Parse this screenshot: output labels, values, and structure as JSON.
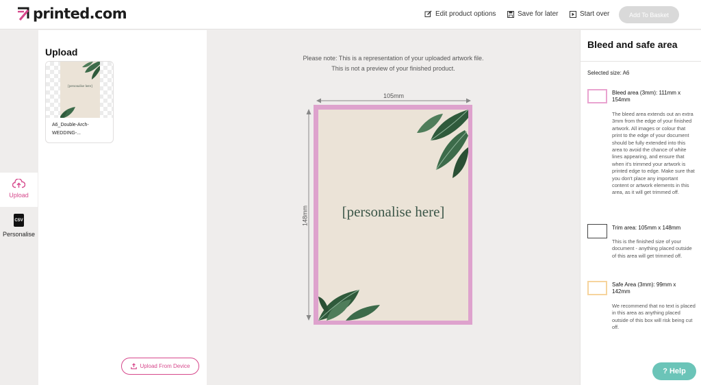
{
  "brand": {
    "name": "printed.com",
    "accent": "#d6478b",
    "help_color": "#6bc4b8"
  },
  "header": {
    "edit_label": "Edit product options",
    "save_label": "Save for later",
    "start_label": "Start over",
    "basket_label": "Add To Basket"
  },
  "rail": {
    "upload_label": "Upload",
    "personalise_label": "Personalise",
    "csv_text": "CSV"
  },
  "upload_panel": {
    "title": "Upload",
    "file_name": "A6_Double-Arch-WEDDING-...",
    "thumb_text": "[personalise here]",
    "upload_button": "Upload From Device"
  },
  "canvas": {
    "note_line1": "Please note: This is a representation of your uploaded artwork file.",
    "note_line2": "This is not a preview of your finished product.",
    "width_label": "105mm",
    "height_label": "148mm",
    "artwork_text": "[personalise here]"
  },
  "info": {
    "title": "Bleed and safe area",
    "selected_size": "Selected size: A6",
    "bleed_label": "Bleed area (3mm): 111mm x 154mm",
    "bleed_desc": "The bleed area extends out an extra 3mm from the edge of your finished artwork. All images or colour that print to the edge of your document should be fully extended into this area to avoid the chance of white lines appearing, and ensure that when it's trimmed your artwork is printed edge to edge. Make sure that you don't place any important content or artwork elements in this area, as it will get trimmed off.",
    "trim_label": "Trim area: 105mm x 148mm",
    "trim_desc": "This is the finished size of your document - anything placed outside of this area will get trimmed off.",
    "safe_label": "Safe Area (3mm): 99mm x 142mm",
    "safe_desc": "We recommend that no text is placed in this area as anything placed outside of this box will risk being cut off."
  },
  "help_label": "? Help"
}
